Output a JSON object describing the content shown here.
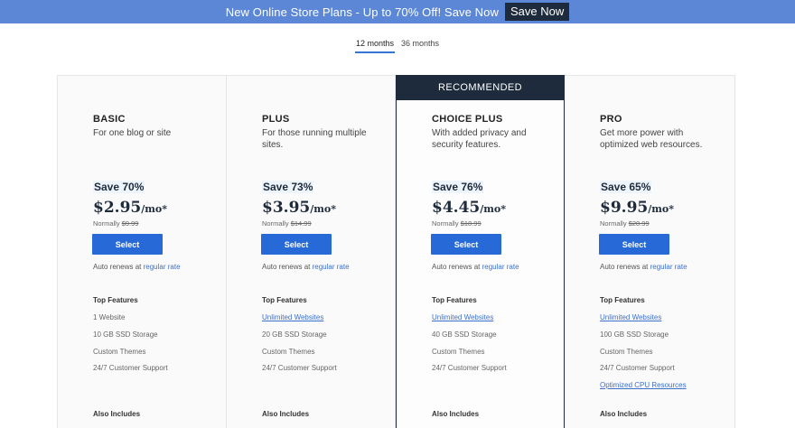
{
  "banner": {
    "text": "New Online Store Plans - Up to 70% Off! Save Now",
    "button": "Save Now"
  },
  "terms": {
    "active": "12 months",
    "other": "36 months"
  },
  "recommended_label": "RECOMMENDED",
  "labels": {
    "select": "Select",
    "auto_renews": "Auto renews at",
    "regular_rate": "regular rate",
    "top_features": "Top Features",
    "also_includes": "Also Includes",
    "normally": "Normally"
  },
  "plans": [
    {
      "name": "BASIC",
      "desc": "For one blog or site",
      "save": "Save 70%",
      "price": "$2.95",
      "per": "/mo*",
      "normal_price": "$9.99",
      "features": [
        {
          "text": "1 Website",
          "link": false
        },
        {
          "text": "10 GB SSD Storage",
          "link": false
        },
        {
          "text": "Custom Themes",
          "link": false
        },
        {
          "text": "24/7 Customer Support",
          "link": false
        }
      ]
    },
    {
      "name": "PLUS",
      "desc": "For those running multiple sites.",
      "save": "Save 73%",
      "price": "$3.95",
      "per": "/mo*",
      "normal_price": "$14.99",
      "features": [
        {
          "text": "Unlimited Websites",
          "link": true
        },
        {
          "text": "20 GB SSD Storage",
          "link": false
        },
        {
          "text": "Custom Themes",
          "link": false
        },
        {
          "text": "24/7 Customer Support",
          "link": false
        }
      ]
    },
    {
      "name": "CHOICE PLUS",
      "desc": "With added privacy and security features.",
      "save": "Save 76%",
      "price": "$4.45",
      "per": "/mo*",
      "normal_price": "$18.99",
      "features": [
        {
          "text": "Unlimited Websites",
          "link": true
        },
        {
          "text": "40 GB SSD Storage",
          "link": false
        },
        {
          "text": "Custom Themes",
          "link": false
        },
        {
          "text": "24/7 Customer Support",
          "link": false
        }
      ]
    },
    {
      "name": "PRO",
      "desc": "Get more power with optimized web resources.",
      "save": "Save 65%",
      "price": "$9.95",
      "per": "/mo*",
      "normal_price": "$28.99",
      "features": [
        {
          "text": "Unlimited Websites",
          "link": true
        },
        {
          "text": "100 GB SSD Storage",
          "link": false
        },
        {
          "text": "Custom Themes",
          "link": false
        },
        {
          "text": "24/7 Customer Support",
          "link": false
        },
        {
          "text": "Optimized CPU Resources",
          "link": true
        }
      ]
    }
  ]
}
